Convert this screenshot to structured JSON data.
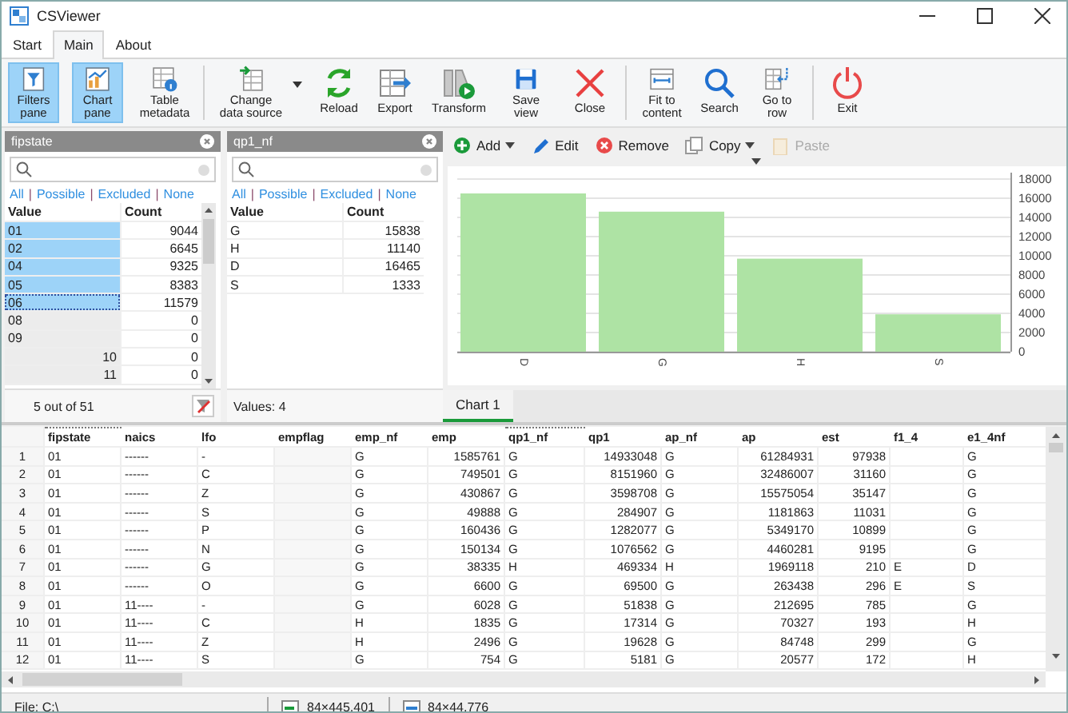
{
  "window": {
    "title": "CSViewer"
  },
  "tabs": [
    {
      "label": "Start",
      "selected": false
    },
    {
      "label": "Main",
      "selected": true
    },
    {
      "label": "About",
      "selected": false
    }
  ],
  "ribbon": [
    {
      "label": "Filters pane",
      "pressed": true
    },
    {
      "label": "Chart pane",
      "pressed": true
    },
    {
      "label": "Table metadata",
      "pressed": false
    },
    {
      "label": "Change data source",
      "pressed": false
    },
    {
      "label": "Reload",
      "pressed": false
    },
    {
      "label": "Export",
      "pressed": false
    },
    {
      "label": "Transform",
      "pressed": false
    },
    {
      "label": "Save view",
      "pressed": false
    },
    {
      "label": "Close",
      "pressed": false
    },
    {
      "label": "Fit to content",
      "pressed": false
    },
    {
      "label": "Search",
      "pressed": false
    },
    {
      "label": "Go to row",
      "pressed": false
    },
    {
      "label": "Exit",
      "pressed": false
    }
  ],
  "filters": [
    {
      "title": "fipstate",
      "links": [
        "All",
        "Possible",
        "Excluded",
        "None"
      ],
      "separator": "|",
      "columns": [
        "Value",
        "Count"
      ],
      "footer": "5 out of 51",
      "scroll": true,
      "rows": [
        {
          "value": "01",
          "count": "9044",
          "kind": "text",
          "selected": true,
          "excluded": false,
          "focused": false
        },
        {
          "value": "02",
          "count": "6645",
          "kind": "text",
          "selected": true,
          "excluded": false,
          "focused": false
        },
        {
          "value": "04",
          "count": "9325",
          "kind": "text",
          "selected": true,
          "excluded": false,
          "focused": false
        },
        {
          "value": "05",
          "count": "8383",
          "kind": "text",
          "selected": true,
          "excluded": false,
          "focused": false
        },
        {
          "value": "06",
          "count": "11579",
          "kind": "text",
          "selected": true,
          "excluded": false,
          "focused": true
        },
        {
          "value": "08",
          "count": "0",
          "kind": "text",
          "selected": false,
          "excluded": true,
          "focused": false
        },
        {
          "value": "09",
          "count": "0",
          "kind": "text",
          "selected": false,
          "excluded": true,
          "focused": false
        },
        {
          "value": "10",
          "count": "0",
          "kind": "number",
          "selected": false,
          "excluded": true,
          "focused": false
        },
        {
          "value": "11",
          "count": "0",
          "kind": "number",
          "selected": false,
          "excluded": true,
          "focused": false
        }
      ]
    },
    {
      "title": "qp1_nf",
      "links": [
        "All",
        "Possible",
        "Excluded",
        "None"
      ],
      "separator": "|",
      "columns": [
        "Value",
        "Count"
      ],
      "footer": "Values: 4",
      "scroll": false,
      "rows": [
        {
          "value": "G",
          "count": "15838",
          "kind": "text",
          "selected": false,
          "excluded": false,
          "focused": false
        },
        {
          "value": "H",
          "count": "11140",
          "kind": "text",
          "selected": false,
          "excluded": false,
          "focused": false
        },
        {
          "value": "D",
          "count": "16465",
          "kind": "text",
          "selected": false,
          "excluded": false,
          "focused": false
        },
        {
          "value": "S",
          "count": "1333",
          "kind": "text",
          "selected": false,
          "excluded": false,
          "focused": false
        }
      ]
    }
  ],
  "chart_toolbar": [
    {
      "label": "Add",
      "dropdown": true,
      "disabled": false
    },
    {
      "label": "Edit",
      "dropdown": false,
      "disabled": false
    },
    {
      "label": "Remove",
      "dropdown": false,
      "disabled": false
    },
    {
      "label": "Copy",
      "dropdown": true,
      "disabled": false
    },
    {
      "label": "Paste",
      "dropdown": false,
      "disabled": true
    }
  ],
  "chart": {
    "chart_data": {
      "type": "bar",
      "categories": [
        "D",
        "G",
        "H",
        "S"
      ],
      "series": [
        {
          "color": "#aee3a4",
          "values": [
            16500,
            14600,
            9700,
            3900
          ]
        }
      ],
      "grid": true,
      "ylim": [
        0,
        18000
      ],
      "yticks": [
        0,
        2000,
        4000,
        6000,
        8000,
        10000,
        12000,
        14000,
        16000,
        18000
      ]
    }
  },
  "chart_tabs": [
    {
      "label": "Chart 1",
      "selected": true
    }
  ],
  "table": {
    "columns": [
      {
        "name": "fipstate",
        "kind": "text",
        "filtered": true
      },
      {
        "name": "naics",
        "kind": "text",
        "filtered": false
      },
      {
        "name": "lfo",
        "kind": "text",
        "filtered": false
      },
      {
        "name": "empflag",
        "kind": "text",
        "filtered": false
      },
      {
        "name": "emp_nf",
        "kind": "text",
        "filtered": false
      },
      {
        "name": "emp",
        "kind": "number",
        "filtered": false
      },
      {
        "name": "qp1_nf",
        "kind": "text",
        "filtered": true
      },
      {
        "name": "qp1",
        "kind": "number",
        "filtered": false
      },
      {
        "name": "ap_nf",
        "kind": "text",
        "filtered": false
      },
      {
        "name": "ap",
        "kind": "number",
        "filtered": false
      },
      {
        "name": "est",
        "kind": "number",
        "filtered": false
      },
      {
        "name": "f1_4",
        "kind": "text",
        "filtered": false
      },
      {
        "name": "e1_4nf",
        "kind": "text",
        "filtered": false
      }
    ],
    "rows": [
      {
        "n": "1",
        "cells": [
          "01",
          "------",
          "-",
          "",
          "G",
          "1585761",
          "G",
          "14933048",
          "G",
          "61284931",
          "97938",
          "",
          "G"
        ]
      },
      {
        "n": "2",
        "cells": [
          "01",
          "------",
          "C",
          "",
          "G",
          "749501",
          "G",
          "8151960",
          "G",
          "32486007",
          "31160",
          "",
          "G"
        ]
      },
      {
        "n": "3",
        "cells": [
          "01",
          "------",
          "Z",
          "",
          "G",
          "430867",
          "G",
          "3598708",
          "G",
          "15575054",
          "35147",
          "",
          "G"
        ]
      },
      {
        "n": "4",
        "cells": [
          "01",
          "------",
          "S",
          "",
          "G",
          "49888",
          "G",
          "284907",
          "G",
          "1181863",
          "11031",
          "",
          "G"
        ]
      },
      {
        "n": "5",
        "cells": [
          "01",
          "------",
          "P",
          "",
          "G",
          "160436",
          "G",
          "1282077",
          "G",
          "5349170",
          "10899",
          "",
          "G"
        ]
      },
      {
        "n": "6",
        "cells": [
          "01",
          "------",
          "N",
          "",
          "G",
          "150134",
          "G",
          "1076562",
          "G",
          "4460281",
          "9195",
          "",
          "G"
        ]
      },
      {
        "n": "7",
        "cells": [
          "01",
          "------",
          "G",
          "",
          "G",
          "38335",
          "H",
          "469334",
          "H",
          "1969118",
          "210",
          "E",
          "D"
        ]
      },
      {
        "n": "8",
        "cells": [
          "01",
          "------",
          "O",
          "",
          "G",
          "6600",
          "G",
          "69500",
          "G",
          "263438",
          "296",
          "E",
          "S"
        ]
      },
      {
        "n": "9",
        "cells": [
          "01",
          "11----",
          "-",
          "",
          "G",
          "6028",
          "G",
          "51838",
          "G",
          "212695",
          "785",
          "",
          "G"
        ]
      },
      {
        "n": "10",
        "cells": [
          "01",
          "11----",
          "C",
          "",
          "H",
          "1835",
          "G",
          "17314",
          "G",
          "70327",
          "193",
          "",
          "H"
        ]
      },
      {
        "n": "11",
        "cells": [
          "01",
          "11----",
          "Z",
          "",
          "H",
          "2496",
          "G",
          "19628",
          "G",
          "84748",
          "299",
          "",
          "G"
        ]
      },
      {
        "n": "12",
        "cells": [
          "01",
          "11----",
          "S",
          "",
          "G",
          "754",
          "G",
          "5181",
          "G",
          "20577",
          "172",
          "",
          "H"
        ]
      }
    ]
  },
  "status_bar": {
    "file": "File: C:\\",
    "rows_info": "84×445,401",
    "cols_info": "84×44,776"
  }
}
